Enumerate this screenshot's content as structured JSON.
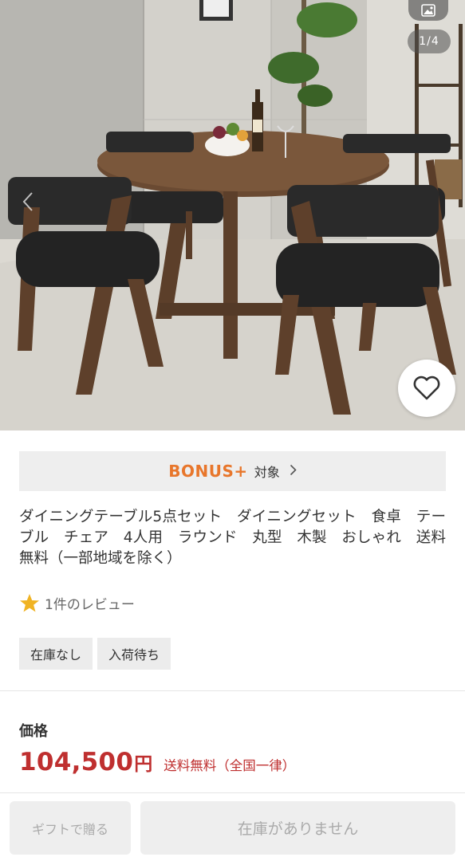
{
  "gallery": {
    "counter": "1/4",
    "image_alt": "ダイニングテーブル5点セット 写真",
    "icons": {
      "image": "image-icon",
      "favorite": "heart-icon",
      "previous": "chevron-left-icon"
    }
  },
  "bonus": {
    "logo": "BONUS+",
    "label": "対象",
    "accent": "#e8762b"
  },
  "product": {
    "title": "ダイニングテーブル5点セット　ダイニングセット　食卓　テーブル　チェア　4人用　ラウンド　丸型　木製　おしゃれ　送料無料（一部地域を除く）"
  },
  "review": {
    "text": "1件のレビュー",
    "star_color": "#f0b323"
  },
  "tags": [
    "在庫なし",
    "入荷待ち"
  ],
  "price": {
    "label": "価格",
    "amount": "104,500",
    "currency": "円",
    "shipping": "送料無料（全国一律）",
    "color": "#bf2f2f"
  },
  "actions": {
    "gift": "ギフトで贈る",
    "stock": "在庫がありません"
  }
}
